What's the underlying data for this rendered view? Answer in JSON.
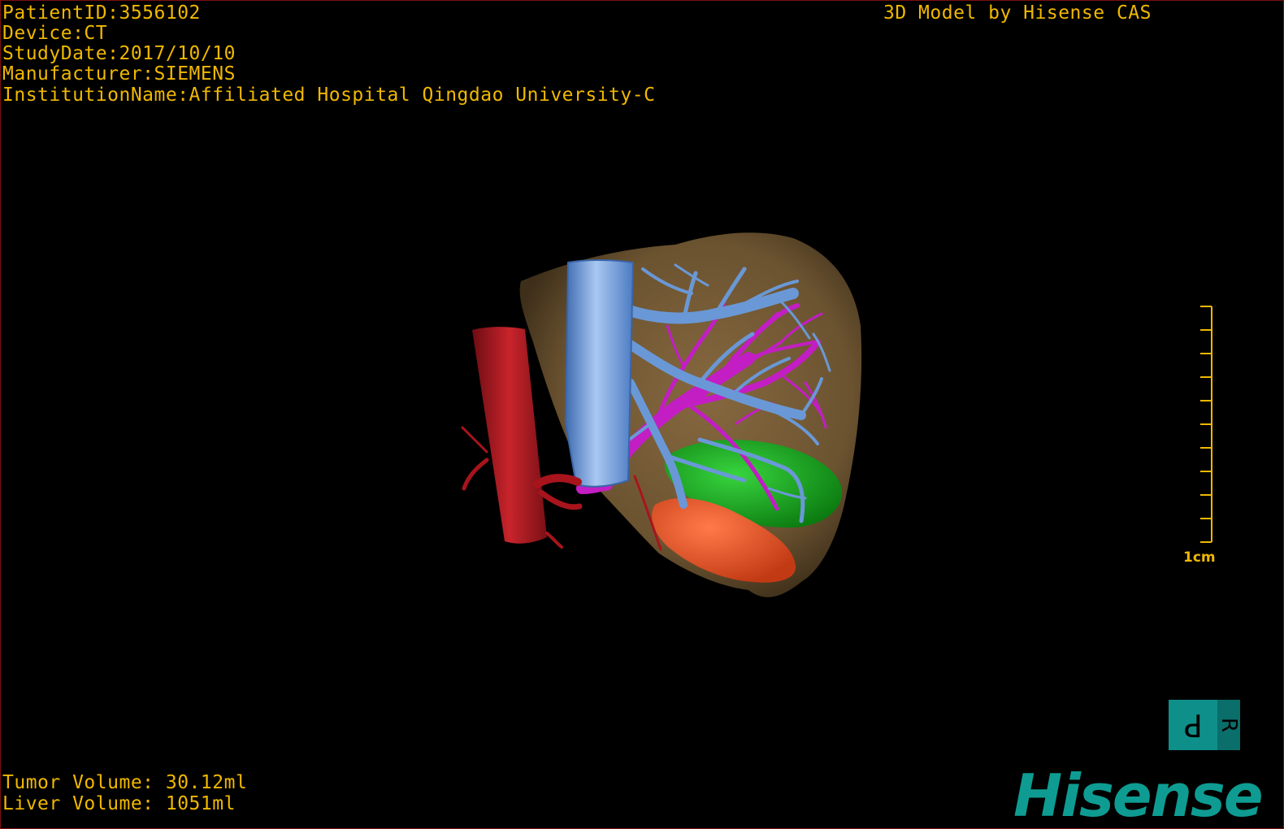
{
  "header": {
    "patient_id": "PatientID:3556102",
    "device": "Device:CT",
    "study_date": "StudyDate:2017/10/10",
    "manufacturer": "Manufacturer:SIEMENS",
    "institution": "InstitutionName:Affiliated Hospital Qingdao University-C",
    "model_credit": "3D Model by Hisense CAS"
  },
  "footer": {
    "tumor_volume": "Tumor Volume: 30.12ml",
    "liver_volume": "Liver Volume: 1051ml"
  },
  "scale": {
    "label": "1cm",
    "tick_count": 10
  },
  "orientation": {
    "left_face": "P",
    "right_face": "R"
  },
  "brand": {
    "logo_text": "Hisense"
  },
  "colors": {
    "overlay_text": "#f0b800",
    "liver": "#6b5330",
    "hepatic_vein": "#5f8fd0",
    "ivc": "#7aa5e0",
    "portal_vein": "#c21ec4",
    "aorta": "#b01822",
    "tumor_green": "#13a81a",
    "tumor_orange": "#f2562a",
    "orientation_cube": "#0f8f8a",
    "brand": "#0e9c92",
    "frame_border": "#7a1010"
  },
  "icons": {
    "orientation": "orientation-cube-icon",
    "scale": "scale-bar-icon"
  }
}
